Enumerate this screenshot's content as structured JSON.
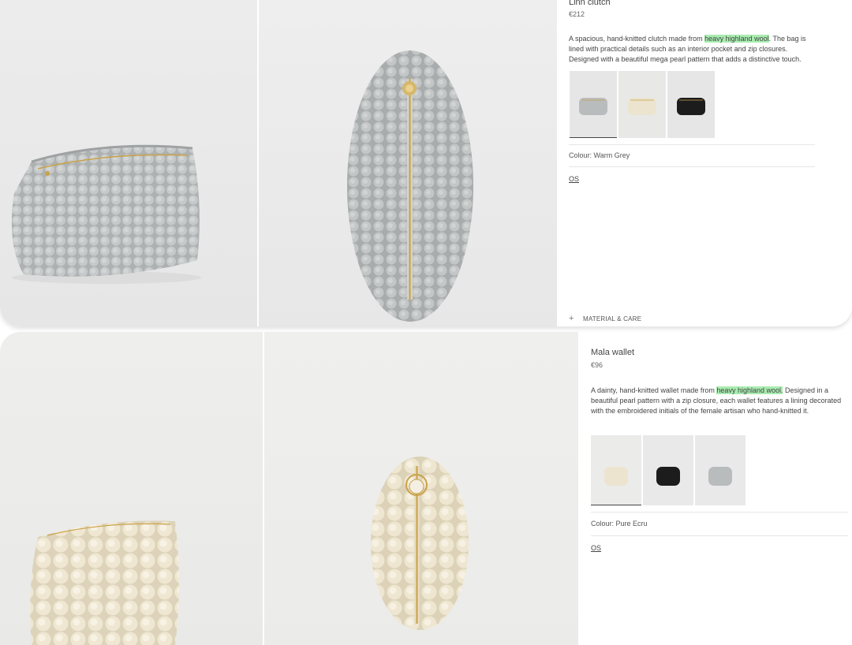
{
  "products": [
    {
      "title": "Linn clutch",
      "price": "€212",
      "desc_before": "A spacious, hand-knitted clutch made from ",
      "desc_highlight": "heavy highland wool",
      "desc_after": ". The bag is lined with practical details such as an interior pocket and zip closures. Designed with a beautiful mega pearl pattern that adds a distinctive touch.",
      "swatches": [
        "grey",
        "ecru",
        "black"
      ],
      "colour_label": "Colour:",
      "colour_value": "Warm Grey",
      "size": "OS",
      "accordion_label": "MATERIAL & CARE"
    },
    {
      "title": "Mala wallet",
      "price": "€96",
      "desc_before": "A dainty, hand-knitted wallet made from ",
      "desc_highlight": "heavy highland wool.",
      "desc_after": " Designed in a beautiful pearl pattern with a zip closure, each wallet features a lining decorated with the embroidered initials of the female artisan who hand-knitted it.",
      "swatches": [
        "ecru",
        "black",
        "grey"
      ],
      "colour_label": "Colour:",
      "colour_value": "Pure Ecru",
      "size": "OS"
    }
  ],
  "colors": {
    "highlight": "#a8ecb0",
    "grey_wool": "#b9bcbc",
    "ecru_wool": "#ece4cf",
    "black_wool": "#1c1c1c",
    "zip_gold": "#c9a24a"
  }
}
